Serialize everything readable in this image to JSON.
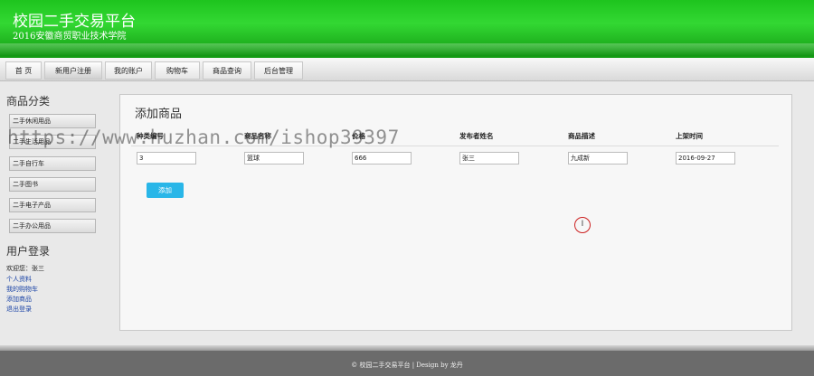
{
  "header": {
    "title": "校园二手交易平台",
    "subtitle": "2016安徽商贸职业技术学院",
    "bg_color": "#22c022"
  },
  "nav": {
    "items": [
      {
        "label": "首 页"
      },
      {
        "label": "新用户注册"
      },
      {
        "label": "我的账户"
      },
      {
        "label": "购物车"
      },
      {
        "label": "商品查询"
      },
      {
        "label": "后台管理"
      }
    ]
  },
  "sidebar": {
    "category_heading": "商品分类",
    "categories": [
      {
        "label": "二手休闲用品"
      },
      {
        "label": "二手生活用品"
      },
      {
        "label": "二手自行车"
      },
      {
        "label": "二手图书"
      },
      {
        "label": "二手电子产品"
      },
      {
        "label": "二手办公用品"
      }
    ],
    "login_heading": "用户登录",
    "welcome": "欢迎您：张三",
    "links": [
      {
        "label": "个人资料"
      },
      {
        "label": "我的购物车"
      },
      {
        "label": "添加商品"
      },
      {
        "label": "退出登录"
      }
    ]
  },
  "main": {
    "title": "添加商品",
    "columns": [
      "种类编号",
      "商品名称",
      "价格",
      "发布者姓名",
      "商品描述",
      "上架时间"
    ],
    "values": [
      "3",
      "篮球",
      "666",
      "张三",
      "九成新",
      "2016-09-27"
    ],
    "add_button": "添加",
    "cursor_glyph": "I"
  },
  "watermark": "https://www.huzhan.com/ishop39397",
  "footer": {
    "text": "© 校园二手交易平台 | Design by 龙丹"
  }
}
